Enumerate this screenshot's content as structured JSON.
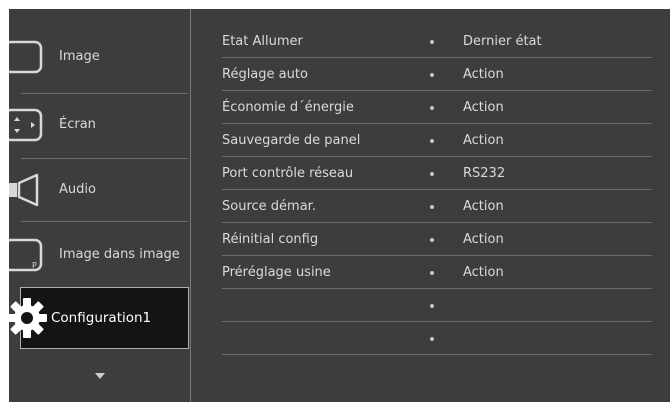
{
  "sidebar": {
    "items": [
      {
        "label": "Image",
        "icon": "picture-icon"
      },
      {
        "label": "Écran",
        "icon": "screen-icon"
      },
      {
        "label": "Audio",
        "icon": "speaker-icon"
      },
      {
        "label": "Image dans image",
        "icon": "pip-icon"
      },
      {
        "label": "Configuration1",
        "icon": "gear-icon",
        "active": true
      }
    ],
    "more_icon": "chevron-down-icon"
  },
  "settings": {
    "rows": [
      {
        "name": "Etat Allumer",
        "value": "Dernier état"
      },
      {
        "name": "Réglage auto",
        "value": "Action"
      },
      {
        "name": "Économie d´énergie",
        "value": "Action"
      },
      {
        "name": "Sauvegarde de panel",
        "value": "Action"
      },
      {
        "name": "Port contrôle réseau",
        "value": "RS232"
      },
      {
        "name": "Source démar.",
        "value": "Action"
      },
      {
        "name": "Réinitial config",
        "value": "Action"
      },
      {
        "name": "Préréglage usine",
        "value": "Action"
      },
      {
        "name": "",
        "value": ""
      },
      {
        "name": "",
        "value": ""
      }
    ]
  },
  "colors": {
    "background": "#3d3d3d",
    "active_item": "#141414",
    "text": "#dadada"
  }
}
